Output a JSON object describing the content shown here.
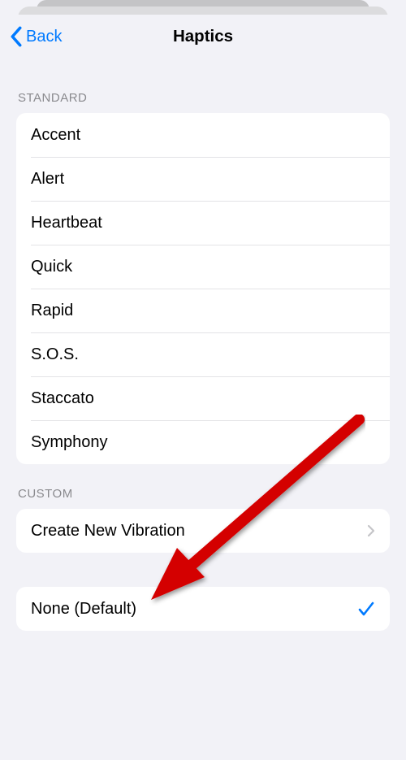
{
  "nav": {
    "back_label": "Back",
    "title": "Haptics"
  },
  "sections": {
    "standard": {
      "header": "STANDARD",
      "items": [
        {
          "label": "Accent"
        },
        {
          "label": "Alert"
        },
        {
          "label": "Heartbeat"
        },
        {
          "label": "Quick"
        },
        {
          "label": "Rapid"
        },
        {
          "label": "S.O.S."
        },
        {
          "label": "Staccato"
        },
        {
          "label": "Symphony"
        }
      ]
    },
    "custom": {
      "header": "CUSTOM",
      "items": [
        {
          "label": "Create New Vibration"
        }
      ]
    },
    "none": {
      "items": [
        {
          "label": "None (Default)",
          "selected": true
        }
      ]
    }
  }
}
